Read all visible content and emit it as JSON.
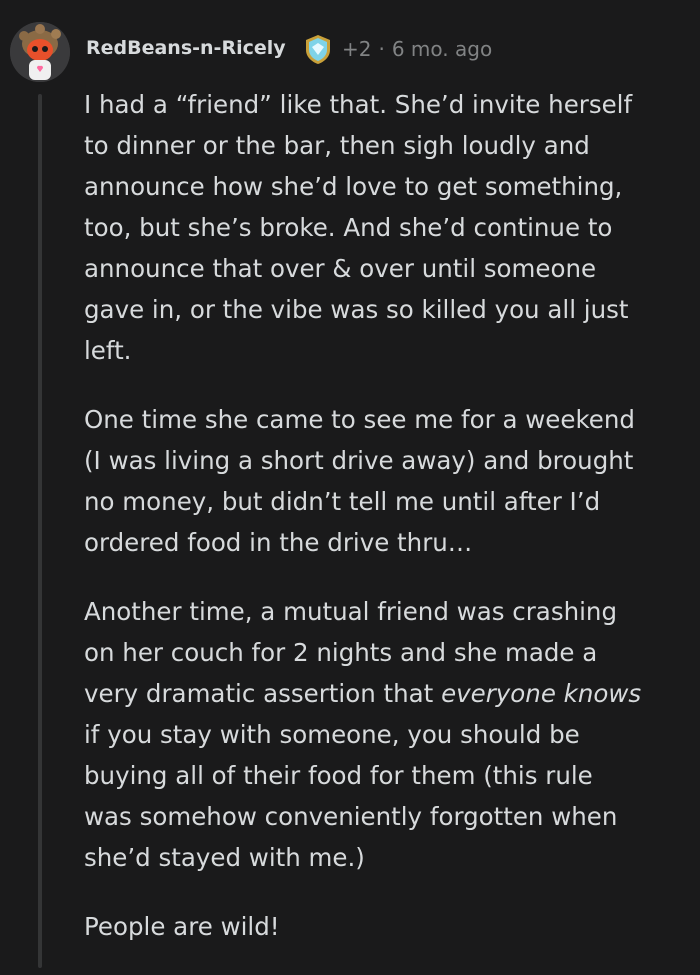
{
  "comment": {
    "username": "RedBeans-n-Ricely",
    "award_icon": "award-badge-icon",
    "score": "+2",
    "separator": "·",
    "age": "6 mo. ago",
    "paragraphs": {
      "p1": "I had a “friend” like that. She’d invite herself\nto dinner or the bar, then sigh loudly and\nannounce how she’d love to get something,\ntoo, but she’s broke. And she’d continue to\nannounce that over & over until someone\ngave in, or the vibe was so killed you all just\nleft.",
      "p2": "One time she came to see me for a weekend\n(I was living a short drive away) and brought\nno money, but didn’t tell me until after I’d\nordered food in the drive thru…",
      "p3_before": "Another time, a mutual friend was crashing\non her couch for 2 nights and she made a\nvery dramatic assertion that ",
      "p3_emphasis": "everyone knows",
      "p3_after": "\nif you stay with someone, you should be\nbuying all of their food for them (this rule\nwas somehow conveniently forgotten when\nshe’d stayed with me.)",
      "p4": "People are wild!"
    }
  },
  "colors": {
    "background": "#1a1a1b",
    "text": "#d7dadc",
    "meta": "#818384",
    "thread_line": "#343536"
  }
}
